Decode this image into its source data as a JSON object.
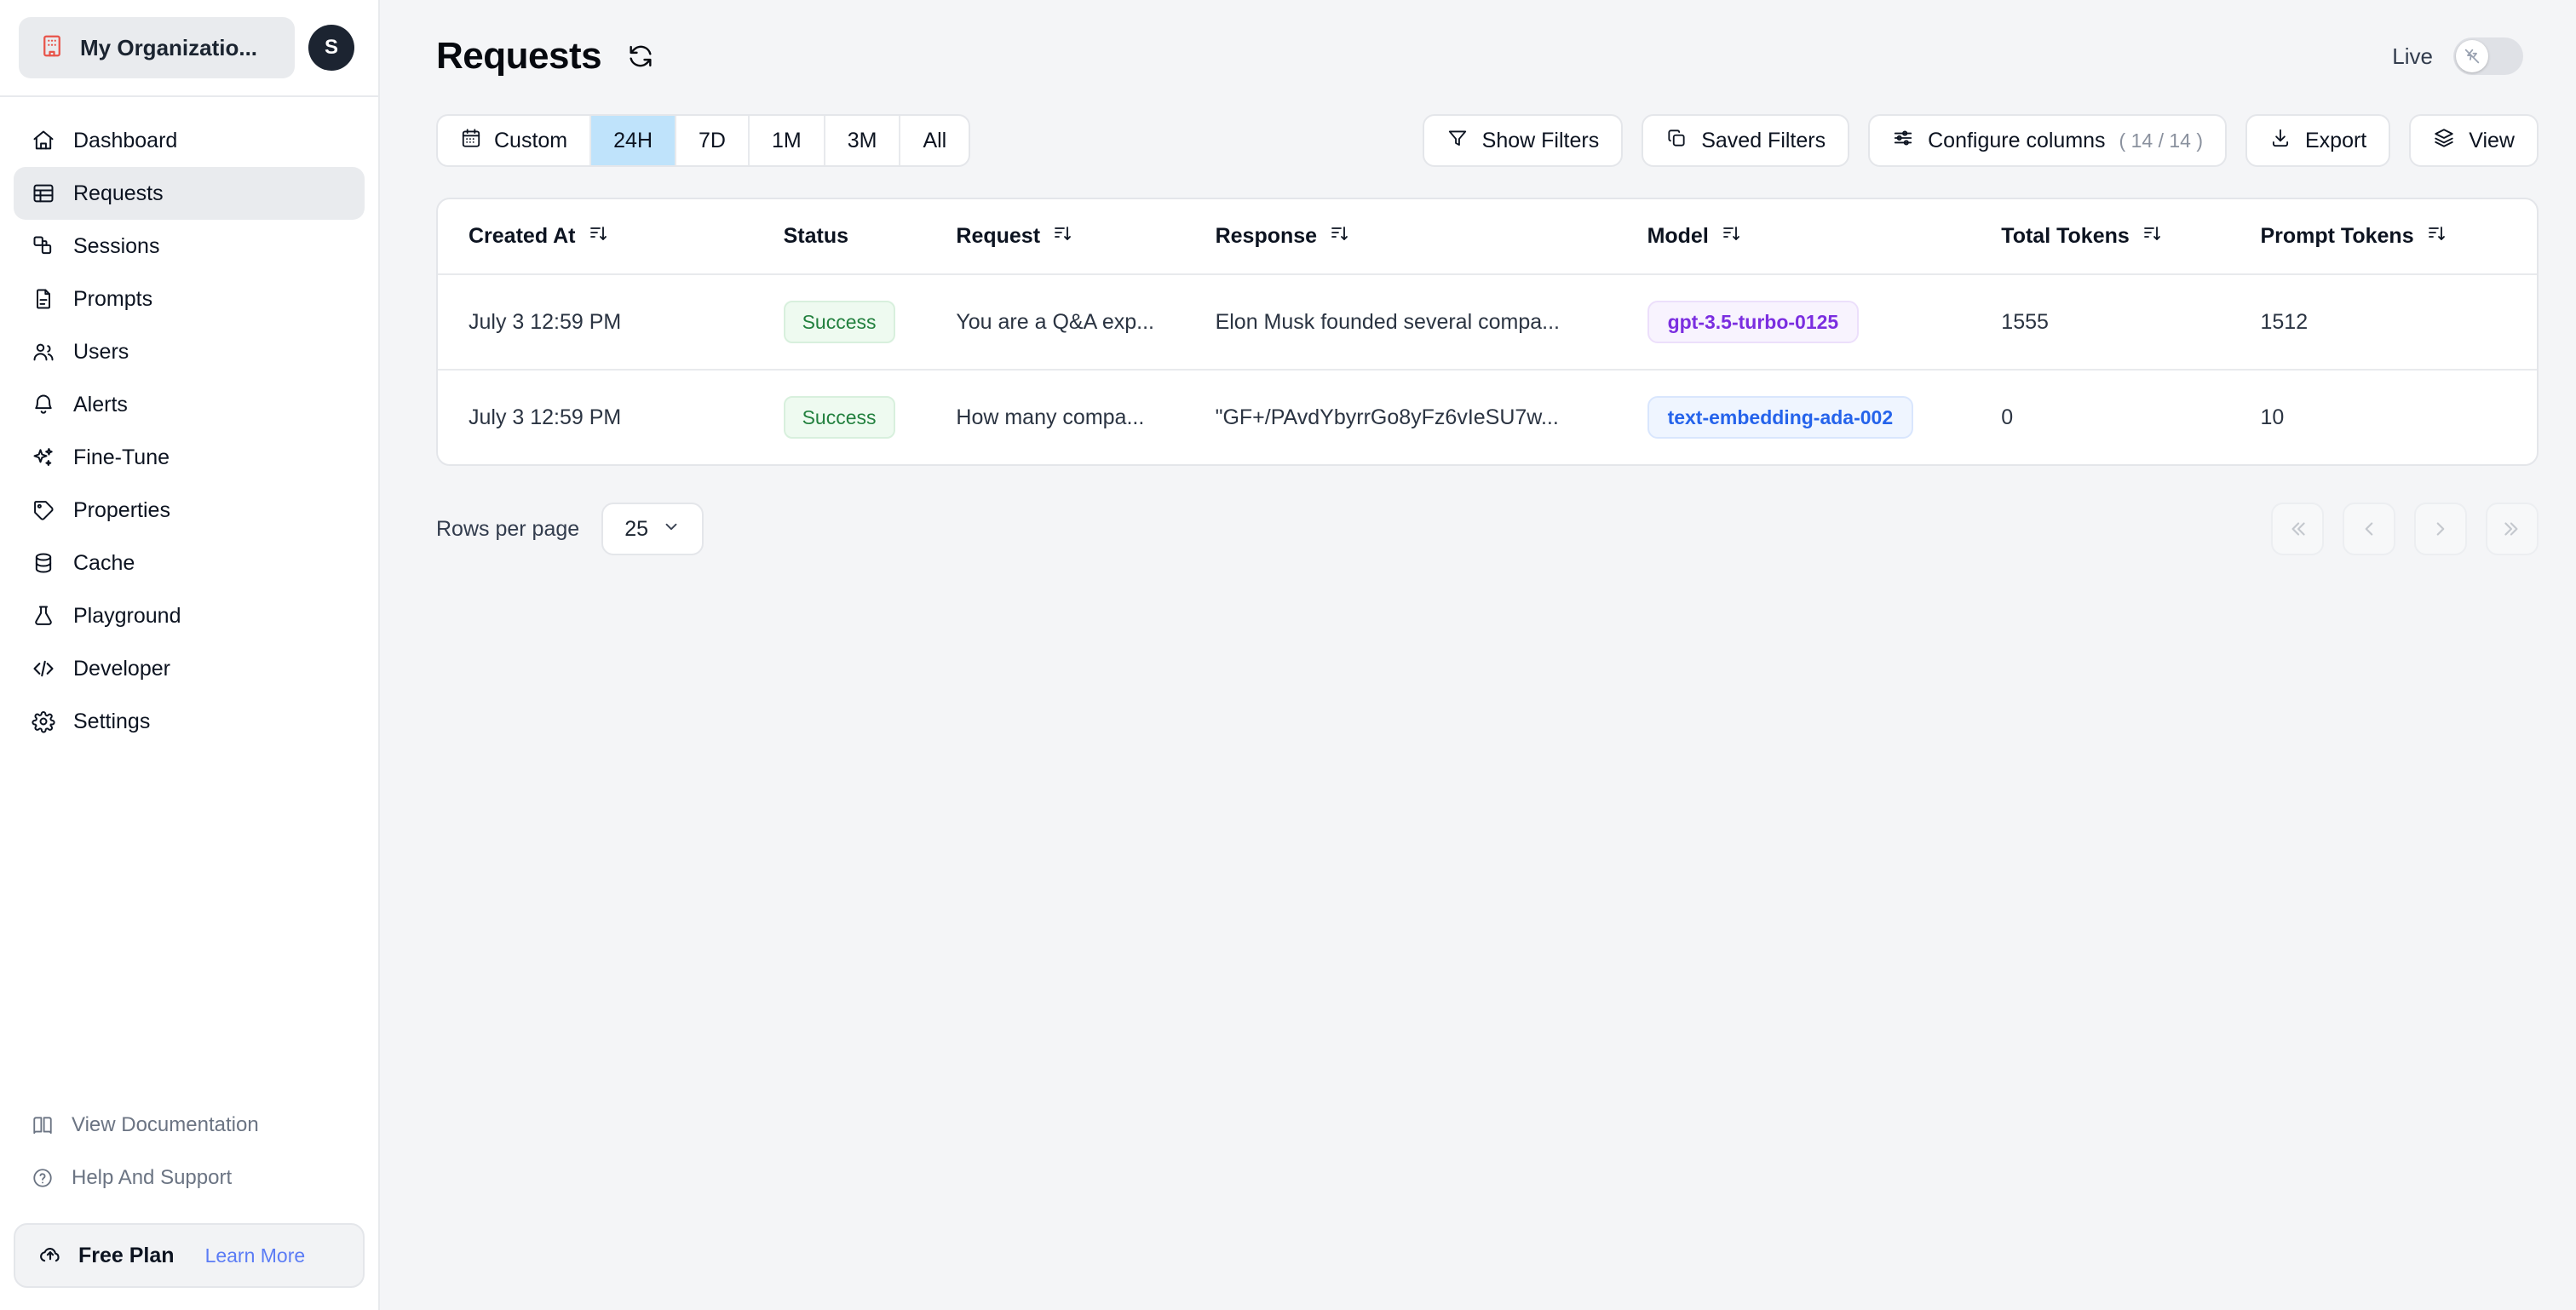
{
  "sidebar": {
    "org": {
      "name": "My Organizatio...",
      "icon": "building-icon"
    },
    "avatar_initial": "S",
    "items": [
      {
        "label": "Dashboard",
        "icon": "home-icon",
        "active": false
      },
      {
        "label": "Requests",
        "icon": "table-icon",
        "active": true
      },
      {
        "label": "Sessions",
        "icon": "layers-icon",
        "active": false
      },
      {
        "label": "Prompts",
        "icon": "file-text-icon",
        "active": false
      },
      {
        "label": "Users",
        "icon": "users-icon",
        "active": false
      },
      {
        "label": "Alerts",
        "icon": "bell-icon",
        "active": false
      },
      {
        "label": "Fine-Tune",
        "icon": "sparkles-icon",
        "active": false
      },
      {
        "label": "Properties",
        "icon": "tag-icon",
        "active": false
      },
      {
        "label": "Cache",
        "icon": "database-icon",
        "active": false
      },
      {
        "label": "Playground",
        "icon": "flask-icon",
        "active": false
      },
      {
        "label": "Developer",
        "icon": "code-icon",
        "active": false
      },
      {
        "label": "Settings",
        "icon": "gear-icon",
        "active": false
      }
    ],
    "footer_links": [
      {
        "label": "View Documentation",
        "icon": "book-icon"
      },
      {
        "label": "Help And Support",
        "icon": "help-circle-icon"
      }
    ],
    "plan": {
      "name": "Free Plan",
      "link": "Learn More",
      "icon": "cloud-upload-icon"
    }
  },
  "header": {
    "title": "Requests",
    "refresh_icon": "refresh-icon",
    "live_label": "Live",
    "live_on": false,
    "live_icon": "zap-off-icon"
  },
  "time_range": {
    "options": [
      {
        "label": "Custom",
        "icon": "calendar-icon",
        "selected": false
      },
      {
        "label": "24H",
        "icon": "",
        "selected": true
      },
      {
        "label": "7D",
        "icon": "",
        "selected": false
      },
      {
        "label": "1M",
        "icon": "",
        "selected": false
      },
      {
        "label": "3M",
        "icon": "",
        "selected": false
      },
      {
        "label": "All",
        "icon": "",
        "selected": false
      }
    ]
  },
  "toolbar": {
    "show_filters": "Show Filters",
    "saved_filters": "Saved Filters",
    "configure_columns": "Configure columns",
    "configure_columns_count": "( 14 / 14 )",
    "export": "Export",
    "view": "View"
  },
  "table": {
    "columns": [
      {
        "label": "Created At",
        "sortable": true
      },
      {
        "label": "Status",
        "sortable": false
      },
      {
        "label": "Request",
        "sortable": true
      },
      {
        "label": "Response",
        "sortable": true
      },
      {
        "label": "Model",
        "sortable": true
      },
      {
        "label": "Total Tokens",
        "sortable": true
      },
      {
        "label": "Prompt Tokens",
        "sortable": true
      }
    ],
    "rows": [
      {
        "created_at": "July 3 12:59 PM",
        "status": "Success",
        "request": "You are a Q&A exp...",
        "response": "Elon Musk founded several compa...",
        "model": "gpt-3.5-turbo-0125",
        "model_color": "purple",
        "total_tokens": "1555",
        "prompt_tokens": "1512"
      },
      {
        "created_at": "July 3 12:59 PM",
        "status": "Success",
        "request": "How many compa...",
        "response": "\"GF+/PAvdYbyrrGo8yFz6vIeSU7w...",
        "model": "text-embedding-ada-002",
        "model_color": "blue",
        "total_tokens": "0",
        "prompt_tokens": "10"
      }
    ]
  },
  "footer": {
    "rows_per_page_label": "Rows per page",
    "rows_per_page_value": "25",
    "pager": [
      {
        "name": "first-page",
        "glyph": "«"
      },
      {
        "name": "prev-page",
        "glyph": "‹"
      },
      {
        "name": "next-page",
        "glyph": "›"
      },
      {
        "name": "last-page",
        "glyph": "»"
      }
    ]
  },
  "colors": {
    "accent_selected": "#bfe3fb",
    "success": "#22803e",
    "model_purple": "#7b2ee0",
    "model_blue": "#2563eb",
    "link": "#5b7cf5",
    "org_icon": "#e8544a"
  }
}
